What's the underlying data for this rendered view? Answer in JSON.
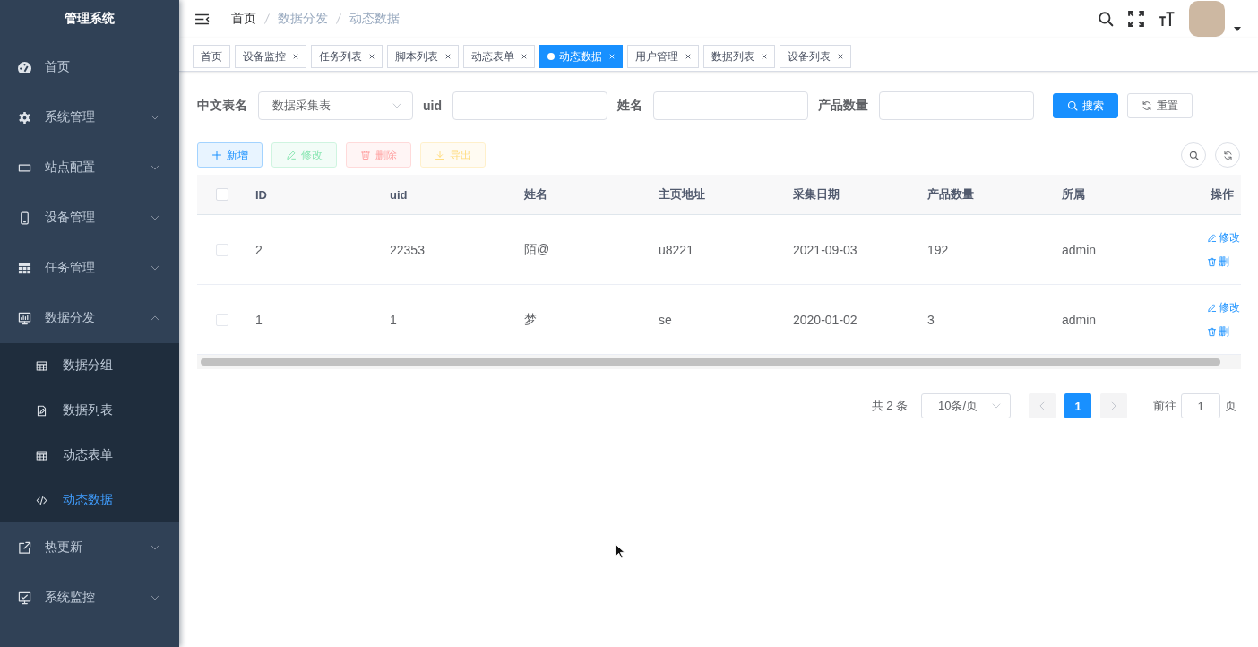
{
  "sidebar": {
    "title": "管理系统",
    "items": [
      {
        "label": "首页"
      },
      {
        "label": "系统管理",
        "expanded": false
      },
      {
        "label": "站点配置",
        "expanded": false
      },
      {
        "label": "设备管理",
        "expanded": false
      },
      {
        "label": "任务管理",
        "expanded": false
      },
      {
        "label": "数据分发",
        "expanded": true,
        "children": [
          {
            "label": "数据分组",
            "selected": false
          },
          {
            "label": "数据列表",
            "selected": false
          },
          {
            "label": "动态表单",
            "selected": false
          },
          {
            "label": "动态数据",
            "selected": true
          }
        ]
      },
      {
        "label": "热更新",
        "expanded": false
      },
      {
        "label": "系统监控",
        "expanded": false
      }
    ]
  },
  "navbar": {
    "breadcrumb": [
      {
        "label": "首页",
        "link": true
      },
      {
        "label": "数据分发",
        "link": false
      },
      {
        "label": "动态数据",
        "link": false
      }
    ]
  },
  "tags": [
    {
      "label": "首页",
      "selected": false,
      "closable": false
    },
    {
      "label": "设备监控",
      "selected": false,
      "closable": true
    },
    {
      "label": "任务列表",
      "selected": false,
      "closable": true
    },
    {
      "label": "脚本列表",
      "selected": false,
      "closable": true
    },
    {
      "label": "动态表单",
      "selected": false,
      "closable": true
    },
    {
      "label": "动态数据",
      "selected": true,
      "closable": true
    },
    {
      "label": "用户管理",
      "selected": false,
      "closable": true
    },
    {
      "label": "数据列表",
      "selected": false,
      "closable": true
    },
    {
      "label": "设备列表",
      "selected": false,
      "closable": true
    }
  ],
  "search_form": {
    "fields": [
      {
        "label": "中文表名",
        "kind": "select",
        "value": "数据采集表"
      },
      {
        "label": "uid",
        "kind": "input"
      },
      {
        "label": "姓名",
        "kind": "input"
      },
      {
        "label": "产品数量",
        "kind": "input"
      }
    ],
    "buttons": [
      {
        "label": "搜索",
        "kind": "primary"
      },
      {
        "label": "重置",
        "kind": "default"
      }
    ]
  },
  "toolbar": {
    "buttons": [
      {
        "label": "新增",
        "kind": "primary",
        "disabled": false
      },
      {
        "label": "修改",
        "kind": "success",
        "disabled": true
      },
      {
        "label": "删除",
        "kind": "danger",
        "disabled": true
      },
      {
        "label": "导出",
        "kind": "warning",
        "disabled": true
      }
    ]
  },
  "table": {
    "header_checked": false,
    "columns": [
      "ID",
      "uid",
      "姓名",
      "主页地址",
      "采集日期",
      "产品数量",
      "所属",
      "操作"
    ],
    "rows": [
      {
        "checked": false,
        "cells": [
          "2",
          "22353",
          "陌@",
          "u8221",
          "2021-09-03",
          "192",
          "admin"
        ],
        "actions": [
          "修改",
          "删"
        ]
      },
      {
        "checked": false,
        "cells": [
          "1",
          "1",
          "梦",
          "se",
          "2020-01-02",
          "3",
          "admin"
        ],
        "actions": [
          "修改",
          "删"
        ]
      }
    ]
  },
  "pagination": {
    "total": "共 2 条",
    "page_size": "10条/页",
    "prev_disabled": true,
    "pages": [
      {
        "label": "1",
        "selected": true
      }
    ],
    "next_disabled": true,
    "jump_label": "前往",
    "jump_value": "1",
    "jump_suffix": "页"
  }
}
